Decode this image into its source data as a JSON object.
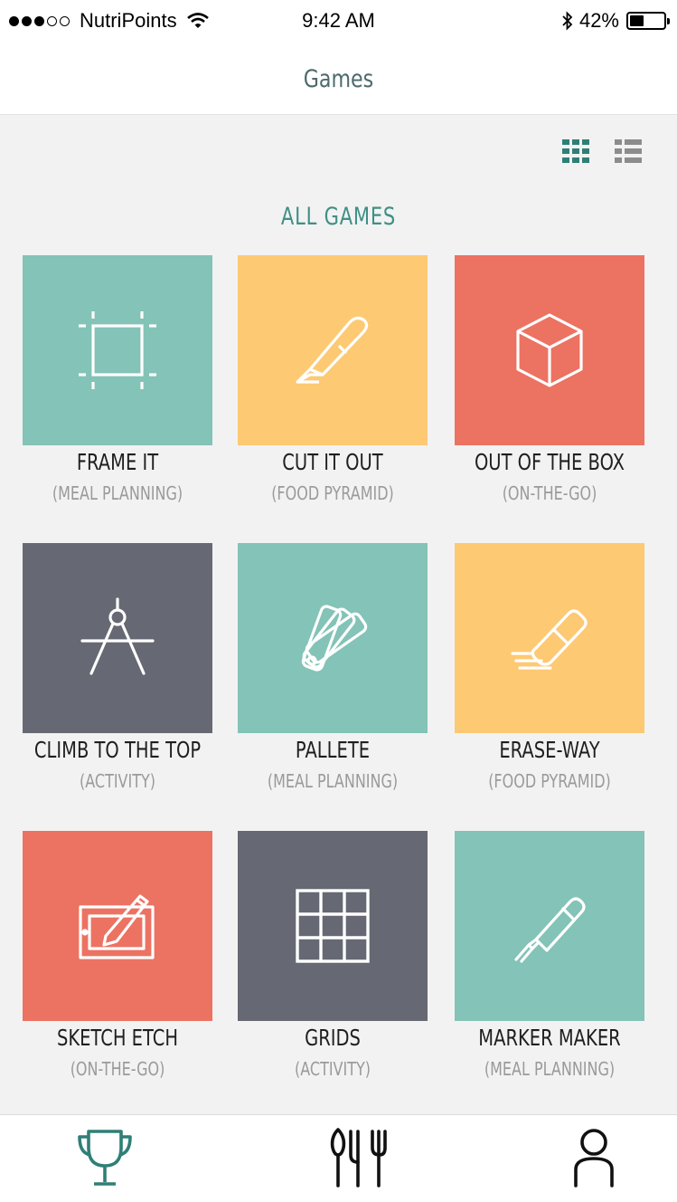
{
  "status_bar": {
    "signal_filled": 3,
    "signal_total": 5,
    "carrier": "NutriPoints",
    "time": "9:42 AM",
    "battery": "42%",
    "battery_level": 0.42
  },
  "navbar": {
    "title": "Games"
  },
  "view_toggle": {
    "active": "grid",
    "active_color": "#2f7f77",
    "inactive_color": "#8c8c8c"
  },
  "section": {
    "title": "ALL GAMES"
  },
  "games": [
    {
      "name": "FRAME IT",
      "category": "(MEAL PLANNING)",
      "color": "#84c3b7",
      "icon": "frame-icon"
    },
    {
      "name": "CUT IT OUT",
      "category": "(FOOD PYRAMID)",
      "color": "#fdc973",
      "icon": "cutter-knife-icon"
    },
    {
      "name": "OUT OF THE BOX",
      "category": "(ON-THE-GO)",
      "color": "#ec7262",
      "icon": "cube-icon"
    },
    {
      "name": "CLIMB TO THE TOP",
      "category": "(ACTIVITY)",
      "color": "#666873",
      "icon": "compass-icon"
    },
    {
      "name": "PALLETE",
      "category": "(MEAL PLANNING)",
      "color": "#84c3b7",
      "icon": "swatches-icon"
    },
    {
      "name": "ERASE-WAY",
      "category": "(FOOD PYRAMID)",
      "color": "#fdc973",
      "icon": "eraser-icon"
    },
    {
      "name": "SKETCH ETCH",
      "category": "(ON-THE-GO)",
      "color": "#ec7262",
      "icon": "drawing-tablet-icon"
    },
    {
      "name": "GRIDS",
      "category": "(ACTIVITY)",
      "color": "#666873",
      "icon": "grid-icon"
    },
    {
      "name": "MARKER MAKER",
      "category": "(MEAL PLANNING)",
      "color": "#84c3b7",
      "icon": "marker-icon"
    }
  ],
  "tabbar": {
    "active": "trophy",
    "active_color": "#2f7f77",
    "inactive_color": "#111111",
    "tabs": [
      "trophy-icon",
      "cutlery-icon",
      "profile-icon"
    ]
  }
}
